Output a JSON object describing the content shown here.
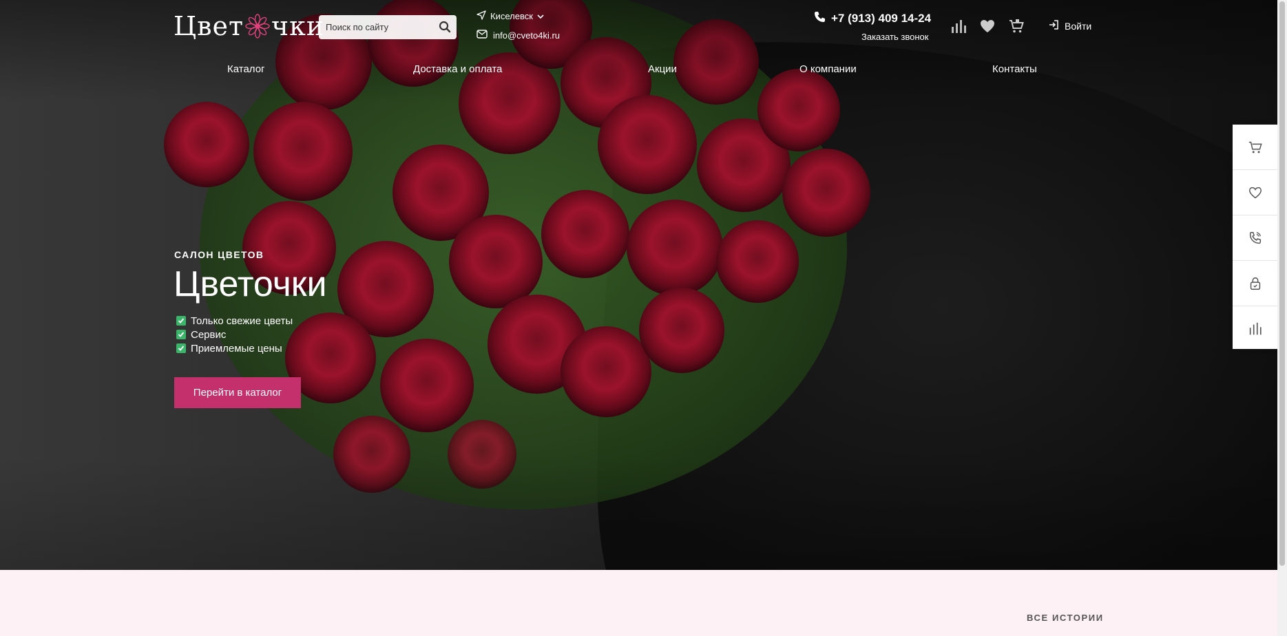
{
  "brand": {
    "logo_text_a": "Цвет",
    "logo_text_b": "чки",
    "accent": "#c4306b"
  },
  "search": {
    "placeholder": "Поиск по сайту"
  },
  "contact": {
    "city": "Киселевск",
    "email": "info@cveto4ki.ru",
    "phone": "+7 (913) 409 14-24",
    "callback": "Заказать звонок"
  },
  "header": {
    "login": "Войти"
  },
  "nav": [
    {
      "label": "Каталог"
    },
    {
      "label": "Доставка и оплата"
    },
    {
      "label": "Акции"
    },
    {
      "label": "О компании"
    },
    {
      "label": "Контакты"
    }
  ],
  "hero": {
    "eyebrow": "САЛОН ЦВЕТОВ",
    "title": "Цветочки",
    "features": [
      "Только свежие цветы",
      "Сервис",
      "Приемлемые цены"
    ],
    "cta": "Перейти в каталог"
  },
  "stories": {
    "all_label": "ВСЕ ИСТОРИИ"
  },
  "icons": {
    "header": [
      "compare-icon",
      "heart-icon",
      "cart-icon"
    ],
    "side": [
      "cart-icon",
      "heart-icon",
      "phone-icon",
      "lock-icon",
      "compare-icon"
    ]
  }
}
